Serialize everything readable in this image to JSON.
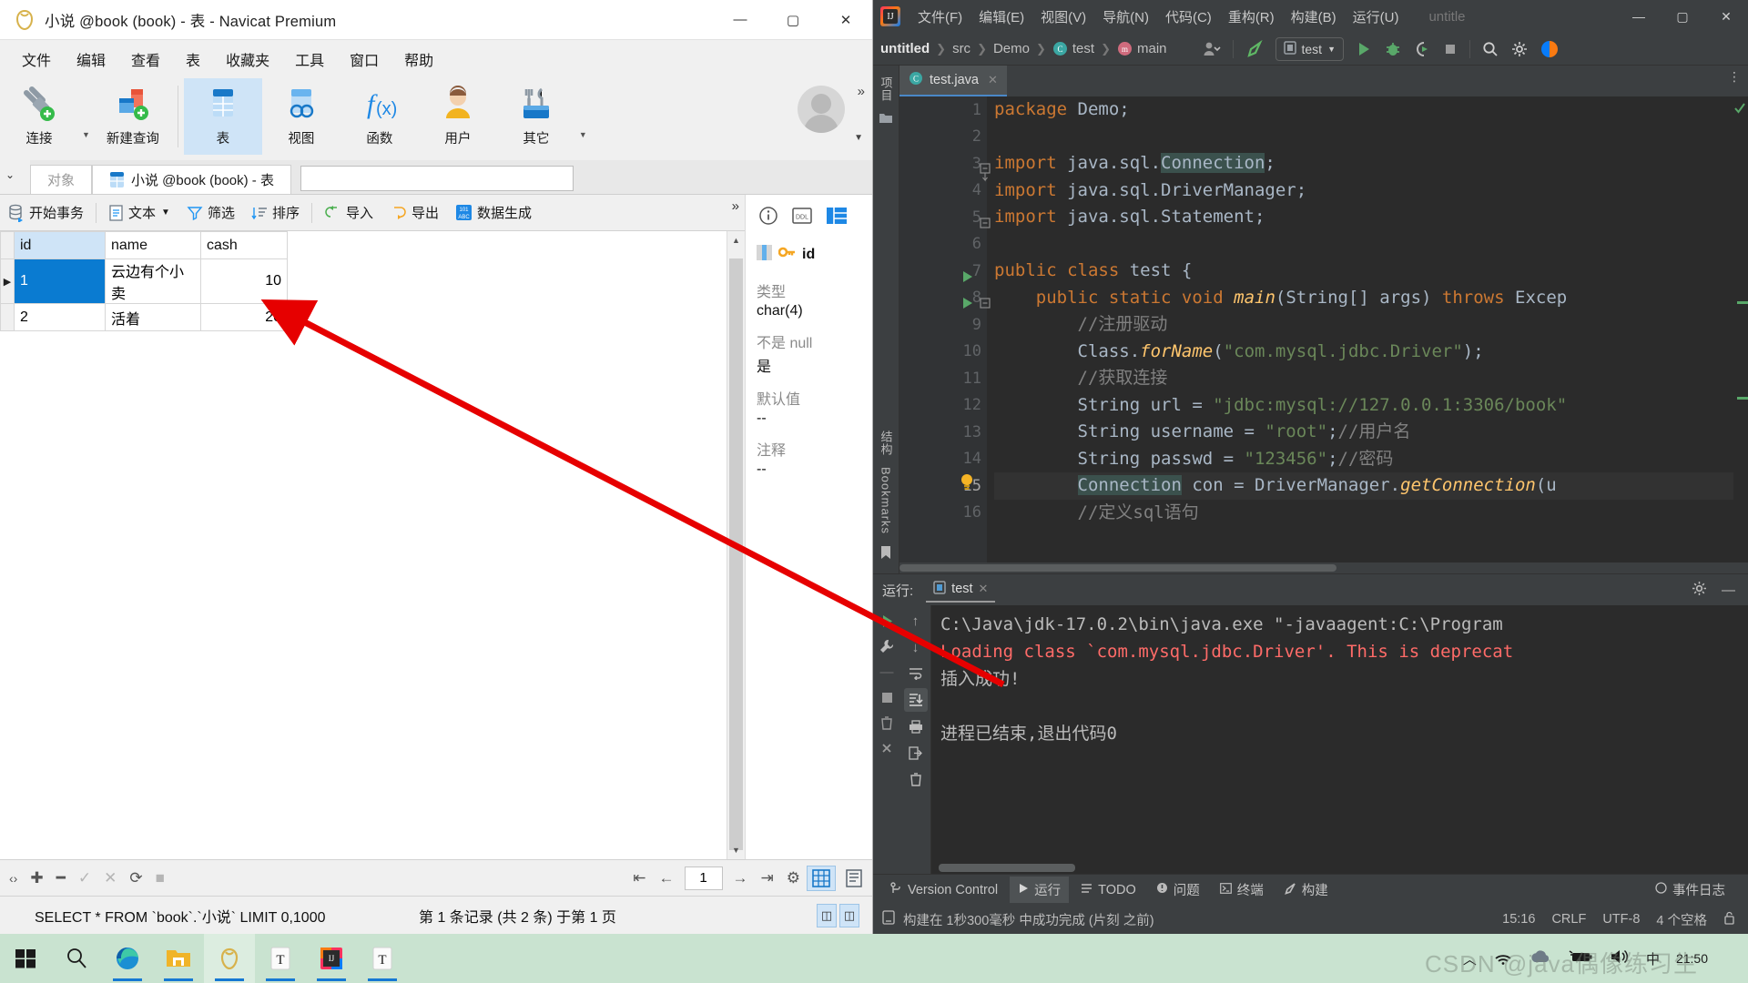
{
  "navicat": {
    "title": "小说 @book (book) - 表 - Navicat Premium",
    "window_controls": {
      "minimize": "—",
      "maximize": "▢",
      "close": "✕"
    },
    "menus": [
      "文件",
      "编辑",
      "查看",
      "表",
      "收藏夹",
      "工具",
      "窗口",
      "帮助"
    ],
    "ribbon": [
      {
        "label": "连接",
        "icon": "connection-icon"
      },
      {
        "label": "新建查询",
        "icon": "new-query-icon"
      },
      {
        "label": "表",
        "icon": "table-icon"
      },
      {
        "label": "视图",
        "icon": "view-icon"
      },
      {
        "label": "函数",
        "icon": "function-icon"
      },
      {
        "label": "用户",
        "icon": "user-icon"
      },
      {
        "label": "其它",
        "icon": "other-icon"
      }
    ],
    "tabs": {
      "objects": "对象",
      "active": "小说 @book (book) - 表"
    },
    "grid_toolbar": [
      "开始事务",
      "文本",
      "筛选",
      "排序",
      "导入",
      "导出",
      "数据生成"
    ],
    "grid": {
      "columns": [
        "id",
        "name",
        "cash"
      ],
      "rows": [
        {
          "id": "1",
          "name": "云边有个小卖",
          "cash": "10",
          "selected": true
        },
        {
          "id": "2",
          "name": "活着",
          "cash": "20",
          "selected": false
        }
      ]
    },
    "side_panel": {
      "field_name": "id",
      "items": [
        {
          "label": "类型",
          "value": "char(4)"
        },
        {
          "label": "不是 null",
          "value": "是"
        },
        {
          "label": "默认值",
          "value": "--"
        },
        {
          "label": "注释",
          "value": "--"
        }
      ]
    },
    "bottom_bar": {
      "page": "1"
    },
    "status": {
      "sql": "SELECT * FROM `book`.`小说` LIMIT 0,1000",
      "record": "第 1 条记录 (共 2 条) 于第 1 页"
    }
  },
  "idea": {
    "window_title": "untitle",
    "menus": [
      "文件(F)",
      "编辑(E)",
      "视图(V)",
      "导航(N)",
      "代码(C)",
      "重构(R)",
      "构建(B)",
      "运行(U)"
    ],
    "window_controls": {
      "minimize": "—",
      "maximize": "▢",
      "close": "✕"
    },
    "breadcrumb": [
      "untitled",
      "src",
      "Demo",
      "test",
      "main"
    ],
    "run_config": "test",
    "editor_tab": "test.java",
    "code_lines": [
      {
        "n": "1",
        "html": "<span class=\"kw\">package</span> Demo;"
      },
      {
        "n": "2",
        "html": ""
      },
      {
        "n": "3",
        "html": "<span class=\"kw\">import</span> java.sql.<span class=\"hl\">Connection</span>;"
      },
      {
        "n": "4",
        "html": "<span class=\"kw\">import</span> java.sql.DriverManager;"
      },
      {
        "n": "5",
        "html": "<span class=\"kw\">import</span> java.sql.Statement;"
      },
      {
        "n": "6",
        "html": ""
      },
      {
        "n": "7",
        "html": "<span class=\"kw\">public class</span> test {"
      },
      {
        "n": "8",
        "html": "    <span class=\"kw\">public static void</span> <span class=\"fn\">main</span>(String[] args) <span class=\"kw\">throws</span> Excep"
      },
      {
        "n": "9",
        "html": "        <span class=\"cmt\">//注册驱动</span>"
      },
      {
        "n": "10",
        "html": "        Class.<span class=\"fn\">forName</span>(<span class=\"str\">\"com.mysql.jdbc.Driver\"</span>);"
      },
      {
        "n": "11",
        "html": "        <span class=\"cmt\">//获取连接</span>"
      },
      {
        "n": "12",
        "html": "        String url = <span class=\"str\">\"jdbc:mysql://127.0.0.1:3306/book\"</span>"
      },
      {
        "n": "13",
        "html": "        String username = <span class=\"str\">\"root\"</span>;<span class=\"cmt\">//用户名</span>"
      },
      {
        "n": "14",
        "html": "        String passwd = <span class=\"str\">\"123456\"</span>;<span class=\"cmt\">//密码</span>"
      },
      {
        "n": "15",
        "html": "        <span class=\"hl\">Connection</span> con = DriverManager.<span class=\"fn\">getConnection</span>(u"
      },
      {
        "n": "16",
        "html": "        <span class=\"cmt\">//定义sql语句</span>"
      }
    ],
    "run_panel": {
      "label": "运行:",
      "tab": "test",
      "console": [
        {
          "text": "C:\\Java\\jdk-17.0.2\\bin\\java.exe \"-javaagent:C:\\Program",
          "error": false
        },
        {
          "text": "Loading class `com.mysql.jdbc.Driver'. This is deprecat",
          "error": true
        },
        {
          "text": "插入成功!",
          "error": false
        },
        {
          "text": "",
          "error": false
        },
        {
          "text": "进程已结束,退出代码0",
          "error": false
        }
      ]
    },
    "tool_windows": [
      "Version Control",
      "运行",
      "TODO",
      "问题",
      "终端",
      "构建"
    ],
    "event_log": "事件日志",
    "status": {
      "build": "构建在 1秒300毫秒 中成功完成 (片刻 之前)",
      "time": "15:16",
      "line_sep": "CRLF",
      "encoding": "UTF-8",
      "indent": "4 个空格"
    }
  },
  "taskbar": {
    "items": [
      {
        "name": "start-button",
        "glyph": "⊞"
      },
      {
        "name": "search-icon",
        "glyph": "○"
      },
      {
        "name": "edge-icon",
        "glyph": "e"
      },
      {
        "name": "file-explorer-icon",
        "glyph": "🗀"
      },
      {
        "name": "navicat-icon",
        "glyph": "N"
      },
      {
        "name": "typora-icon",
        "glyph": "T"
      },
      {
        "name": "intellij-idea-icon",
        "glyph": "IJ"
      },
      {
        "name": "typora-icon-2",
        "glyph": "T"
      }
    ],
    "tray": {
      "ime": "中",
      "time": "21:50"
    },
    "watermark": "CSDN @java偶像练习生"
  },
  "colors": {
    "navicat_accent": "#0a7bd1",
    "navicat_selection": "#cfe4f7",
    "idea_bg": "#3c3f41",
    "idea_editor_bg": "#2b2b2b",
    "idea_keyword": "#cc7832",
    "idea_string": "#6a8759",
    "idea_error": "#ff6b68",
    "arrow": "#e60000",
    "taskbar_bg": "#c9e3d0"
  }
}
